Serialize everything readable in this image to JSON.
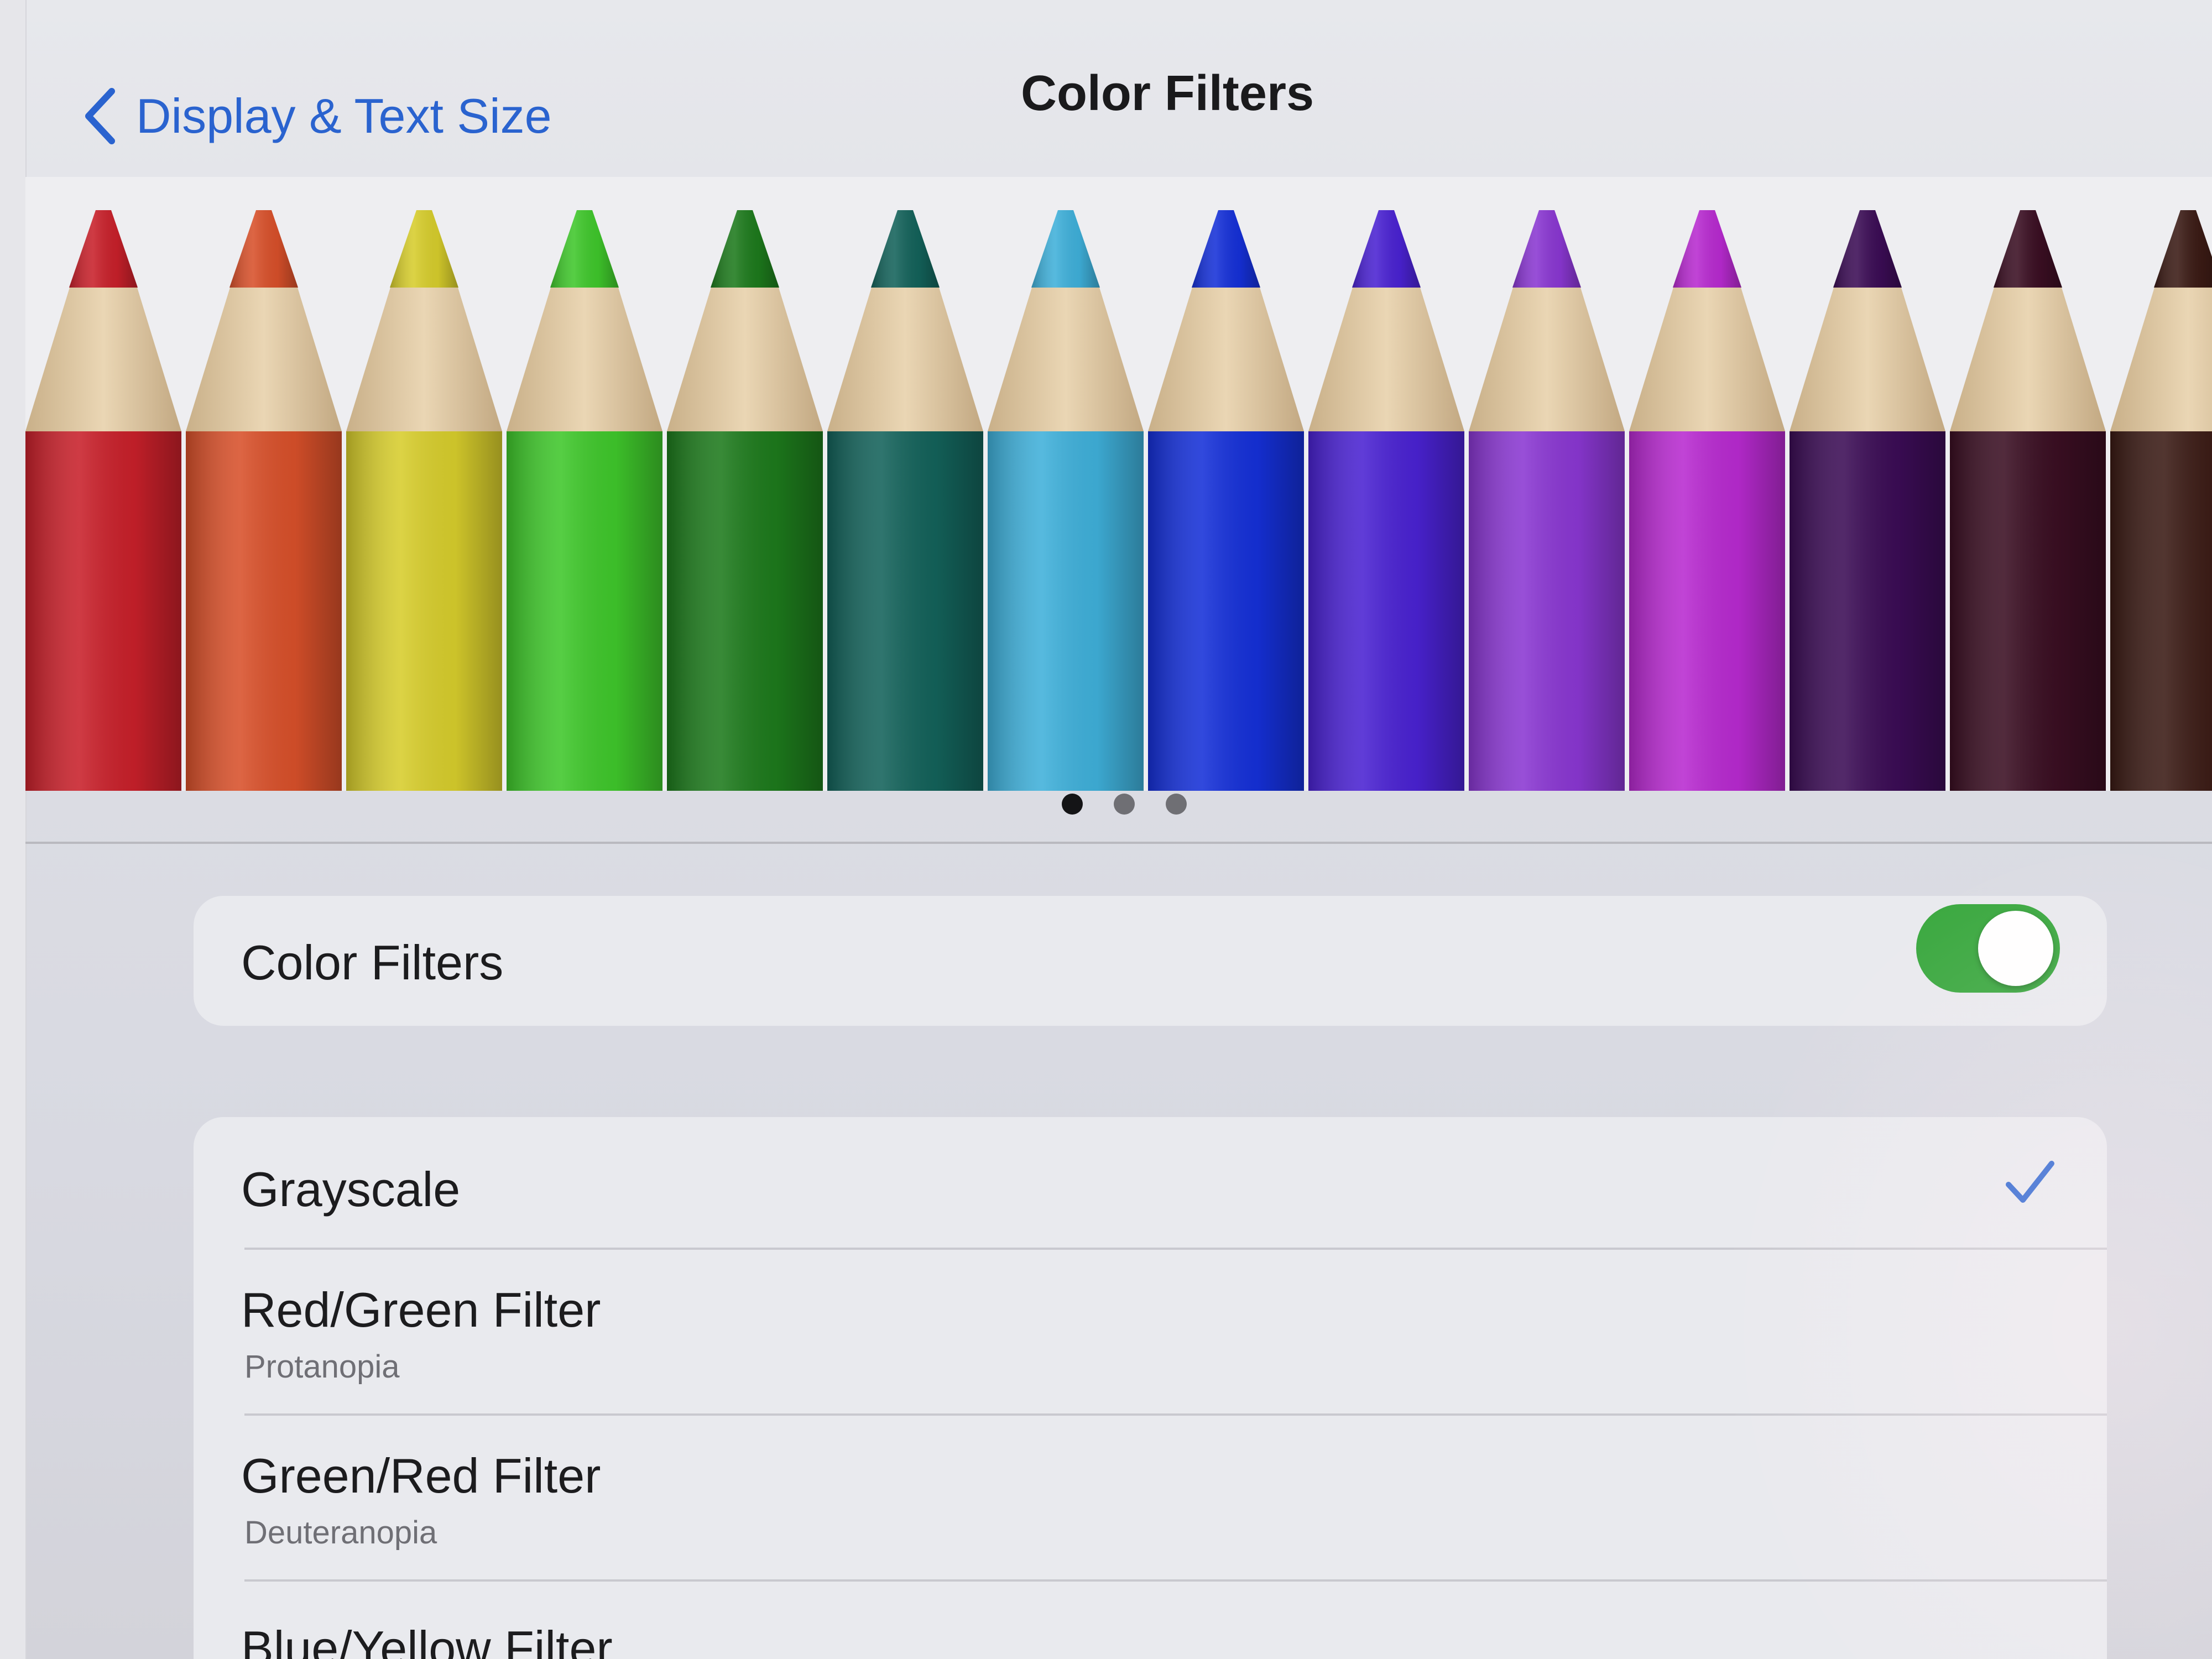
{
  "nav": {
    "back_label": "Display & Text Size",
    "title": "Color Filters"
  },
  "preview": {
    "pencil_colors": [
      "#c8202a",
      "#d8502a",
      "#d7cd2c",
      "#3fc72b",
      "#1d7a1c",
      "#13625a",
      "#3fb0da",
      "#1530d8",
      "#4a22d2",
      "#8a37d2",
      "#b82ad0",
      "#3b0c55",
      "#3a0e22",
      "#3a1a14"
    ],
    "page_count": 3,
    "active_page": 1
  },
  "toggle_group": {
    "label": "Color Filters",
    "enabled": true,
    "toggle_color": "#3aa83f"
  },
  "options": {
    "items": [
      {
        "label": "Grayscale",
        "subtitle": "",
        "selected": true
      },
      {
        "label": "Red/Green Filter",
        "subtitle": "Protanopia",
        "selected": false
      },
      {
        "label": "Green/Red Filter",
        "subtitle": "Deuteranopia",
        "selected": false
      },
      {
        "label": "Blue/Yellow Filter",
        "subtitle": "",
        "selected": false
      }
    ]
  },
  "colors": {
    "accent": "#2a63cf"
  }
}
